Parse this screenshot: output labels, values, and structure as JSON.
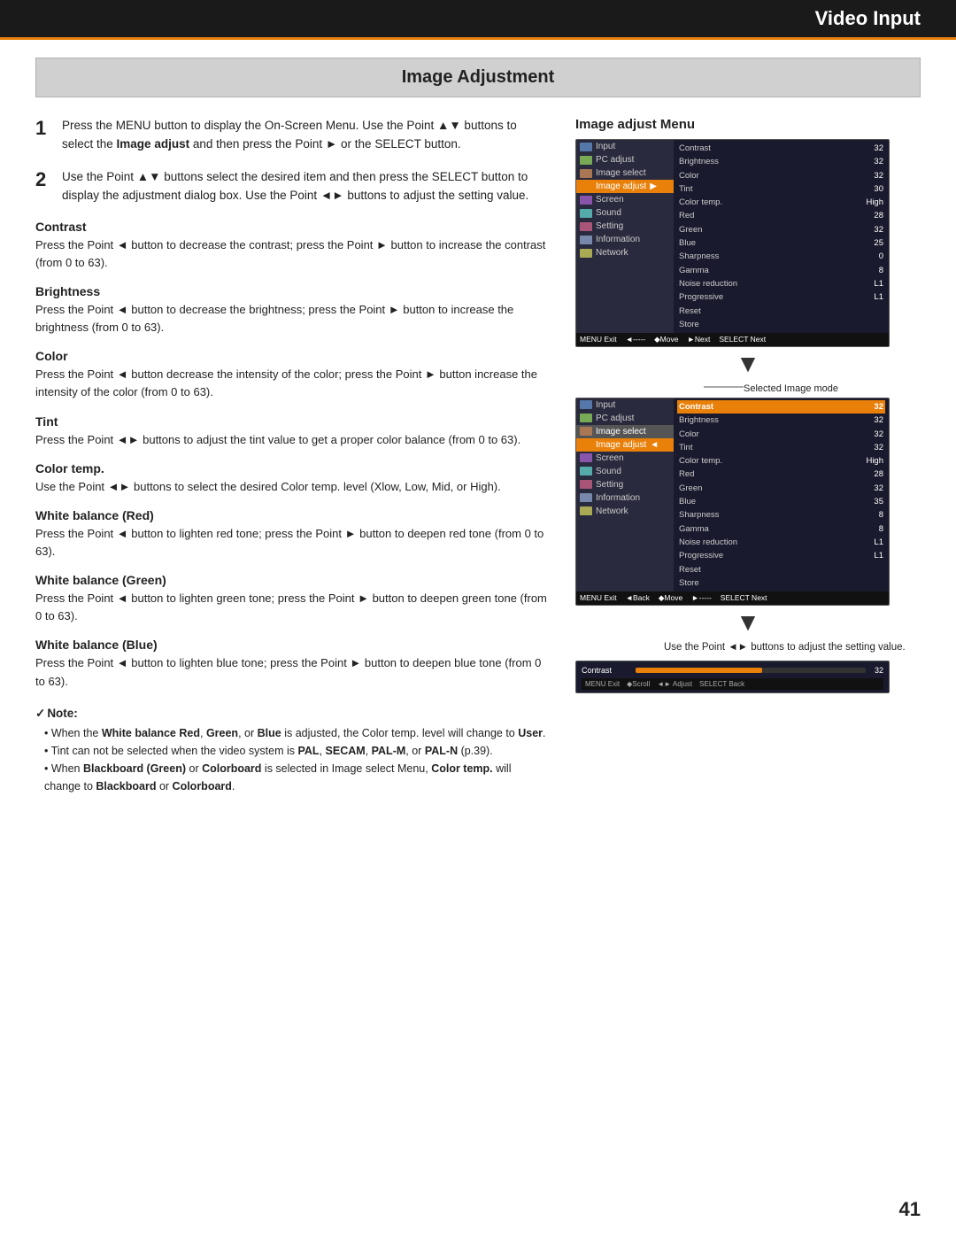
{
  "header": {
    "title": "Video Input"
  },
  "section": {
    "title": "Image Adjustment"
  },
  "steps": [
    {
      "number": "1",
      "text": "Press the MENU button to display the On-Screen Menu. Use the Point ▲▼ buttons to select the ",
      "bold1": "Image adjust",
      "text2": " and then press the Point ► or the SELECT button."
    },
    {
      "number": "2",
      "text": "Use the Point ▲▼ buttons select the desired item and then press the SELECT button to display the adjustment dialog box. Use the Point ◄► buttons to adjust the setting value."
    }
  ],
  "subsections": [
    {
      "id": "contrast",
      "title": "Contrast",
      "body": "Press the Point ◄ button to decrease the contrast; press the Point ► button to increase the contrast (from 0 to 63)."
    },
    {
      "id": "brightness",
      "title": "Brightness",
      "body": "Press the Point ◄ button to decrease the brightness; press the Point ► button to increase the brightness (from 0 to 63)."
    },
    {
      "id": "color",
      "title": "Color",
      "body": "Press the Point ◄ button decrease the intensity of the color; press the Point ► button increase the intensity of the color (from 0 to 63)."
    },
    {
      "id": "tint",
      "title": "Tint",
      "body": "Press the Point ◄► buttons to adjust the tint value to get a proper color balance (from 0 to 63)."
    },
    {
      "id": "color-temp",
      "title": "Color temp.",
      "body": "Use the Point ◄► buttons to select the desired Color temp. level (Xlow, Low, Mid, or High)."
    },
    {
      "id": "white-red",
      "title": "White balance (Red)",
      "body": "Press the Point ◄ button to lighten red tone; press the Point ► button to deepen red tone (from 0 to 63)."
    },
    {
      "id": "white-green",
      "title": "White balance (Green)",
      "body": "Press the Point ◄ button to lighten green tone; press the Point ► button to deepen green tone (from 0 to 63)."
    },
    {
      "id": "white-blue",
      "title": "White balance (Blue)",
      "body": "Press the Point ◄ button to lighten blue tone; press the Point ► button to deepen blue tone (from 0 to 63)."
    }
  ],
  "note": {
    "title": "Note:",
    "items": [
      "When the White balance Red, Green, or Blue is adjusted, the Color temp. level will change to User.",
      "Tint can not be selected when the video system is PAL, SECAM, PAL-M, or PAL-N (p.39).",
      "When Blackboard (Green) or Colorboard is selected in Image select Menu, Color temp. will change to Blackboard or Colorboard."
    ]
  },
  "right_panel": {
    "title": "Image adjust Menu",
    "menu1": {
      "items": [
        "Input",
        "PC adjust",
        "Image select",
        "Image adjust",
        "Screen",
        "Sound",
        "Setting",
        "Information",
        "Network"
      ],
      "active": "Image adjust",
      "right_rows": [
        {
          "label": "Contrast",
          "value": "32"
        },
        {
          "label": "Brightness",
          "value": "32"
        },
        {
          "label": "Color",
          "value": "32"
        },
        {
          "label": "Tint",
          "value": "30"
        },
        {
          "label": "Color temp.",
          "value": "High"
        },
        {
          "label": "Red",
          "value": "28"
        },
        {
          "label": "Green",
          "value": "32"
        },
        {
          "label": "Blue",
          "value": "25"
        },
        {
          "label": "Sharpness",
          "value": "0"
        },
        {
          "label": "Gamma",
          "value": "8"
        },
        {
          "label": "Noise reduction",
          "value": "L1"
        },
        {
          "label": "Progressive",
          "value": "L1"
        },
        {
          "label": "Reset",
          "value": ""
        },
        {
          "label": "Store",
          "value": ""
        }
      ],
      "statusbar": [
        "MENU Exit",
        "◄-----",
        "◆Move",
        "►Next",
        "SELECT Next"
      ]
    },
    "annotation": "Selected Image mode",
    "menu2": {
      "items": [
        "Input",
        "PC adjust",
        "Image select",
        "Image adjust",
        "Screen",
        "Sound",
        "Setting",
        "Information",
        "Network"
      ],
      "active": "Image adjust",
      "right_rows": [
        {
          "label": "Contrast",
          "value": "32",
          "highlight": true
        },
        {
          "label": "Brightness",
          "value": "32"
        },
        {
          "label": "Color",
          "value": "32"
        },
        {
          "label": "Tint",
          "value": "32"
        },
        {
          "label": "Color temp.",
          "value": "High"
        },
        {
          "label": "Red",
          "value": "28"
        },
        {
          "label": "Green",
          "value": "32"
        },
        {
          "label": "Blue",
          "value": "35"
        },
        {
          "label": "Sharpness",
          "value": "8"
        },
        {
          "label": "Gamma",
          "value": "8"
        },
        {
          "label": "Noise reduction",
          "value": "L1"
        },
        {
          "label": "Progressive",
          "value": "L1"
        },
        {
          "label": "Reset",
          "value": ""
        },
        {
          "label": "Store",
          "value": ""
        }
      ],
      "statusbar": [
        "MENU Exit",
        "◄Back",
        "◆Move",
        "►-----",
        "SELECT Next"
      ]
    },
    "use_point_text": "Use the Point ◄► buttons to adjust the setting value.",
    "slider": {
      "label": "Contrast",
      "value": "32",
      "fill_percent": 55,
      "statusbar": [
        "MENU Exit",
        "◆Scroll",
        "◄► Adjust",
        "SELECT Back"
      ]
    }
  },
  "page_number": "41"
}
